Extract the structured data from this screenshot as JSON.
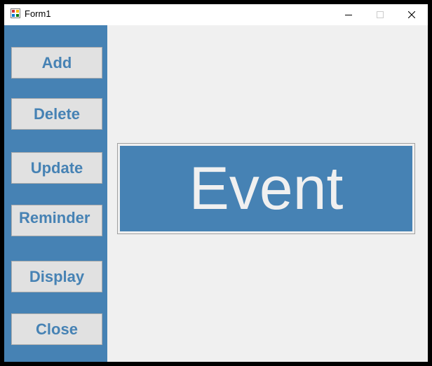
{
  "window": {
    "title": "Form1"
  },
  "icons": {
    "app": "app-form-icon",
    "minimize": "minimize-icon",
    "maximize": "maximize-icon",
    "close": "close-icon"
  },
  "sidebar": {
    "buttons": [
      {
        "label": "Add"
      },
      {
        "label": "Delete"
      },
      {
        "label": "Update"
      },
      {
        "label": "Reminder"
      },
      {
        "label": "Display"
      },
      {
        "label": "Close"
      }
    ]
  },
  "main": {
    "event_label": "Event"
  },
  "colors": {
    "accent": "#4682b4",
    "button_face": "#e1e1e1",
    "event_text": "#f0f0f0",
    "background": "#f0f0f0"
  }
}
